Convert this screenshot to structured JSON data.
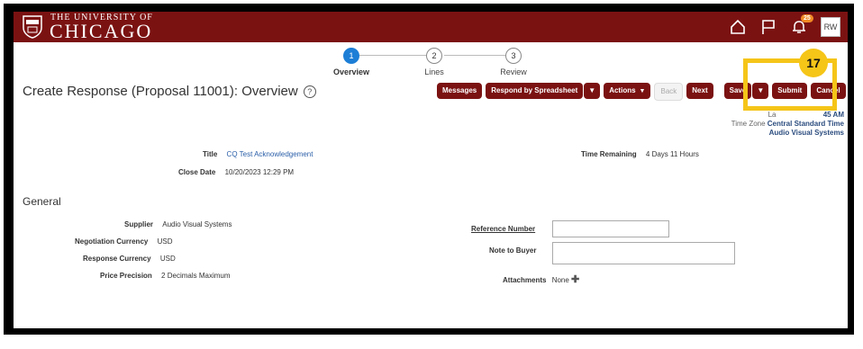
{
  "header": {
    "logo_small": "THE UNIVERSITY OF",
    "logo_big": "CHICAGO",
    "notification_count": "25",
    "avatar_initials": "RW"
  },
  "train": {
    "steps": [
      {
        "num": "1",
        "label": "Overview"
      },
      {
        "num": "2",
        "label": "Lines"
      },
      {
        "num": "3",
        "label": "Review"
      }
    ]
  },
  "page": {
    "title": "Create Response (Proposal 11001): Overview",
    "help_glyph": "?"
  },
  "toolbar": {
    "messages": "Messages",
    "respond_by_spreadsheet": "Respond by Spreadsheet",
    "actions": "Actions",
    "back": "Back",
    "next": "Next",
    "save": "Save",
    "submit": "Submit",
    "cancel": "Cancel"
  },
  "meta": {
    "last_saved_label": "La",
    "last_saved_value": "45 AM",
    "time_zone_label": "Time Zone",
    "time_zone_value": "Central Standard Time",
    "supplier_name": "Audio Visual Systems"
  },
  "callout": {
    "number": "17"
  },
  "summary": {
    "title_label": "Title",
    "title_value": "CQ Test Acknowledgement",
    "close_date_label": "Close Date",
    "close_date_value": "10/20/2023 12:29 PM",
    "time_remaining_label": "Time Remaining",
    "time_remaining_value": "4 Days 11 Hours"
  },
  "general": {
    "heading": "General",
    "supplier_label": "Supplier",
    "supplier_value": "Audio Visual Systems",
    "neg_currency_label": "Negotiation Currency",
    "neg_currency_value": "USD",
    "resp_currency_label": "Response Currency",
    "resp_currency_value": "USD",
    "price_precision_label": "Price Precision",
    "price_precision_value": "2 Decimals Maximum",
    "reference_number_label": "Reference Number",
    "reference_number_value": "",
    "note_to_buyer_label": "Note to Buyer",
    "note_to_buyer_value": "",
    "attachments_label": "Attachments",
    "attachments_value": "None"
  }
}
